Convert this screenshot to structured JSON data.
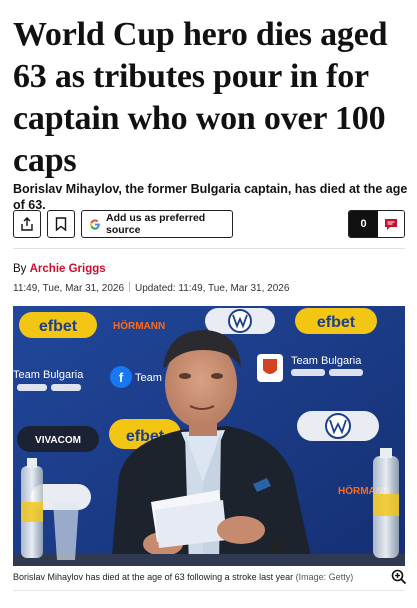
{
  "article": {
    "headline": "World Cup hero dies aged 63 as tributes pour in for captain who won over 100 caps",
    "standfirst": "Borislav Mihaylov, the former Bulgaria captain, has died at the age of 63.",
    "byline_prefix": "By",
    "author": "Archie Griggs",
    "published": "11:49, Tue, Mar 31, 2026",
    "updated": "Updated: 11:49, Tue, Mar 31, 2026"
  },
  "actions": {
    "share_icon": "share-icon",
    "bookmark_icon": "bookmark-icon",
    "source_label": "Add us as preferred source",
    "comment_count": "0",
    "comment_icon": "comment-icon"
  },
  "image": {
    "caption": "Borislav Mihaylov has died at the age of 63 following a stroke last year",
    "credit": "(Image: Getty)",
    "backdrop_texts": {
      "efbet": "efbet",
      "hormann": "HÖRMANN",
      "team_bulgaria": "Team Bulgaria",
      "vivacom": "VIVACOM",
      "team": "Team"
    }
  },
  "colors": {
    "author_red": "#c8102e",
    "backdrop_blue": "#1d3f8e",
    "efbet_yellow": "#f3c613"
  }
}
